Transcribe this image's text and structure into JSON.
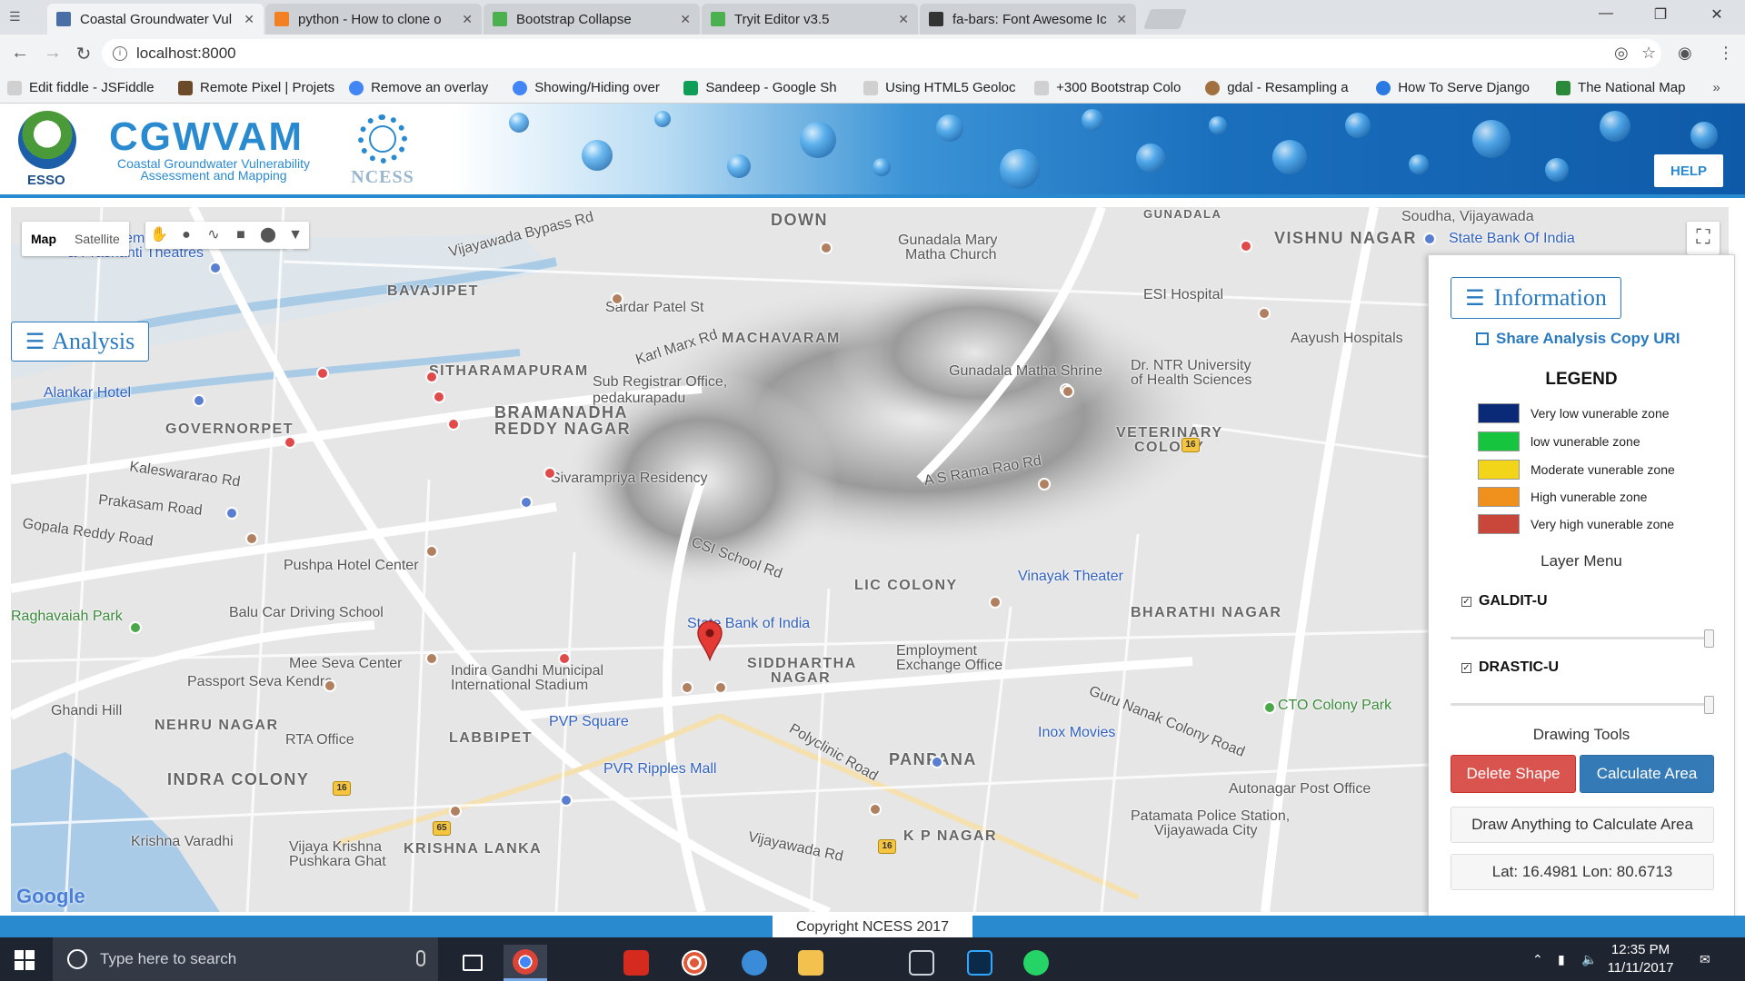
{
  "browser": {
    "tabs": [
      {
        "label": "Coastal Groundwater Vul",
        "icon": "page-icon",
        "color": "#4a6fa5"
      },
      {
        "label": "python - How to clone o",
        "icon": "stackoverflow-icon",
        "color": "#f48024"
      },
      {
        "label": "Bootstrap Collapse",
        "icon": "w3schools-icon",
        "color": "#4caf50"
      },
      {
        "label": "Tryit Editor v3.5",
        "icon": "w3schools-icon",
        "color": "#4caf50"
      },
      {
        "label": "fa-bars: Font Awesome Ic",
        "icon": "flag-icon",
        "color": "#333333"
      }
    ],
    "address": "localhost:8000",
    "bookmarks": [
      {
        "label": "Edit fiddle - JSFiddle",
        "color": "#d0d0d0"
      },
      {
        "label": "Remote Pixel | Projets",
        "color": "#6b4a2a"
      },
      {
        "label": "Remove an overlay",
        "color": "#4285f4"
      },
      {
        "label": "Showing/Hiding over",
        "color": "#4285f4"
      },
      {
        "label": "Sandeep - Google Sh",
        "color": "#0f9d58"
      },
      {
        "label": "Using HTML5 Geoloc",
        "color": "#d0d0d0"
      },
      {
        "label": "+300 Bootstrap Colo",
        "color": "#d0d0d0"
      },
      {
        "label": "gdal - Resampling a",
        "color": "#a07040"
      },
      {
        "label": "How To Serve Django",
        "color": "#2a7ae2"
      },
      {
        "label": "The National Map",
        "color": "#2a8a3a"
      }
    ]
  },
  "header": {
    "logo_left": "ESSO",
    "title": "CGWVAM",
    "subtitle": "Coastal Groundwater Vulnerability Assessment and Mapping",
    "logo_right": "NCESS",
    "help_label": "HELP"
  },
  "map": {
    "map_label": "Map",
    "satellite_label": "Satellite",
    "analysis_label": "Analysis",
    "google": "Google",
    "labels": [
      {
        "t": "Miraj Cinema Shanti",
        "c": "blue"
      },
      {
        "t": "& Prashanti Theatres",
        "c": "blue"
      },
      {
        "t": "BAVAJIPET",
        "c": "area"
      },
      {
        "t": "Vijayawada Bypass Rd",
        "c": ""
      },
      {
        "t": "DOWN",
        "c": "area"
      },
      {
        "t": "Gunadala Mary",
        "c": ""
      },
      {
        "t": "Matha Church",
        "c": ""
      },
      {
        "t": "GUNADALA",
        "c": "area"
      },
      {
        "t": "Soudha, Vijayawada",
        "c": ""
      },
      {
        "t": "VISHNU NAGAR",
        "c": "area"
      },
      {
        "t": "State Bank Of India",
        "c": "blue"
      },
      {
        "t": "ESI Hospital",
        "c": ""
      },
      {
        "t": "Sardar Patel St",
        "c": ""
      },
      {
        "t": "MACHAVARAM",
        "c": "area"
      },
      {
        "t": "Karl Marx Rd",
        "c": ""
      },
      {
        "t": "Aayush Hospitals",
        "c": ""
      },
      {
        "t": "Alankar Hotel",
        "c": "blue"
      },
      {
        "t": "SITHARAMAPURAM",
        "c": "area"
      },
      {
        "t": "Sub Registrar Office,",
        "c": ""
      },
      {
        "t": "pedakurapadu",
        "c": ""
      },
      {
        "t": "Gunadala Matha Shrine",
        "c": ""
      },
      {
        "t": "Dr. NTR University",
        "c": ""
      },
      {
        "t": "of Health Sciences",
        "c": ""
      },
      {
        "t": "GOVERNORPET",
        "c": "area"
      },
      {
        "t": "BRAMANADHA",
        "c": "area"
      },
      {
        "t": "REDDY NAGAR",
        "c": "area"
      },
      {
        "t": "VETERINARY",
        "c": "area"
      },
      {
        "t": "COLONY",
        "c": "area"
      },
      {
        "t": "Kaleswararao Rd",
        "c": ""
      },
      {
        "t": "Prakasam Road",
        "c": ""
      },
      {
        "t": "Sivarampriya Residency",
        "c": ""
      },
      {
        "t": "A S Rama Rao Rd",
        "c": ""
      },
      {
        "t": "Gopala Reddy Road",
        "c": ""
      },
      {
        "t": "Pushpa Hotel Center",
        "c": ""
      },
      {
        "t": "CSI School Rd",
        "c": ""
      },
      {
        "t": "LIC COLONY",
        "c": "area"
      },
      {
        "t": "Vinayak Theater",
        "c": "blue"
      },
      {
        "t": "Raghavaiah Park",
        "c": "green"
      },
      {
        "t": "Balu Car Driving School",
        "c": ""
      },
      {
        "t": "State Bank of India",
        "c": "blue"
      },
      {
        "t": "BHARATHI NAGAR",
        "c": "area"
      },
      {
        "t": "Mee Seva Center",
        "c": ""
      },
      {
        "t": "Indira Gandhi Municipal",
        "c": ""
      },
      {
        "t": "International Stadium",
        "c": ""
      },
      {
        "t": "SIDDHARTHA",
        "c": "area"
      },
      {
        "t": "NAGAR",
        "c": "area"
      },
      {
        "t": "Employment",
        "c": ""
      },
      {
        "t": "Exchange Office",
        "c": ""
      },
      {
        "t": "Passport Seva Kendra",
        "c": ""
      },
      {
        "t": "CTO Colony Park",
        "c": "green"
      },
      {
        "t": "Ghandi Hill",
        "c": ""
      },
      {
        "t": "NEHRU NAGAR",
        "c": "area"
      },
      {
        "t": "PVP Square",
        "c": "blue"
      },
      {
        "t": "Guru Nanak Colony Road",
        "c": ""
      },
      {
        "t": "RTA Office",
        "c": ""
      },
      {
        "t": "LABBIPET",
        "c": "area"
      },
      {
        "t": "Inox Movies",
        "c": "blue"
      },
      {
        "t": "INDRA COLONY",
        "c": "area"
      },
      {
        "t": "PVR Ripples Mall",
        "c": "blue"
      },
      {
        "t": "PANPANA",
        "c": "area"
      },
      {
        "t": "Autonagar Post Office",
        "c": ""
      },
      {
        "t": "Patamata Police Station,",
        "c": ""
      },
      {
        "t": "Vijayawada City",
        "c": ""
      },
      {
        "t": "Krishna Varadhi",
        "c": ""
      },
      {
        "t": "Vijaya Krishna",
        "c": ""
      },
      {
        "t": "Pushkara Ghat",
        "c": ""
      },
      {
        "t": "KRISHNA LANKA",
        "c": "area"
      },
      {
        "t": "K P NAGAR",
        "c": "area"
      },
      {
        "t": "Vijayawada Rd",
        "c": ""
      },
      {
        "t": "Polyclinic Road",
        "c": ""
      }
    ]
  },
  "panel": {
    "info_label": "Information",
    "share_label": "Share Analysis Copy URI",
    "legend_title": "LEGEND",
    "legend": [
      {
        "label": "Very low vunerable zone",
        "color": "#0a2a78"
      },
      {
        "label": "low vunerable zone",
        "color": "#17c43d"
      },
      {
        "label": "Moderate vunerable zone",
        "color": "#f2d518"
      },
      {
        "label": "High vunerable zone",
        "color": "#ef8f1c"
      },
      {
        "label": "Very high vunerable zone",
        "color": "#c9463a"
      }
    ],
    "layer_menu_title": "Layer Menu",
    "layers": [
      {
        "name": "GALDIT-U",
        "checked": true,
        "opacity": 1.0
      },
      {
        "name": "DRASTIC-U",
        "checked": true,
        "opacity": 1.0
      }
    ],
    "drawing_tools_title": "Drawing Tools",
    "delete_label": "Delete Shape",
    "calc_label": "Calculate Area",
    "area_output": "Draw Anything to Calculate Area",
    "latlon": "Lat: 16.4981 Lon: 80.6713"
  },
  "footer": {
    "copyright": "Copyright NCESS 2017"
  },
  "taskbar": {
    "search_placeholder": "Type here to search",
    "time": "12:35 PM",
    "date": "11/11/2017"
  }
}
